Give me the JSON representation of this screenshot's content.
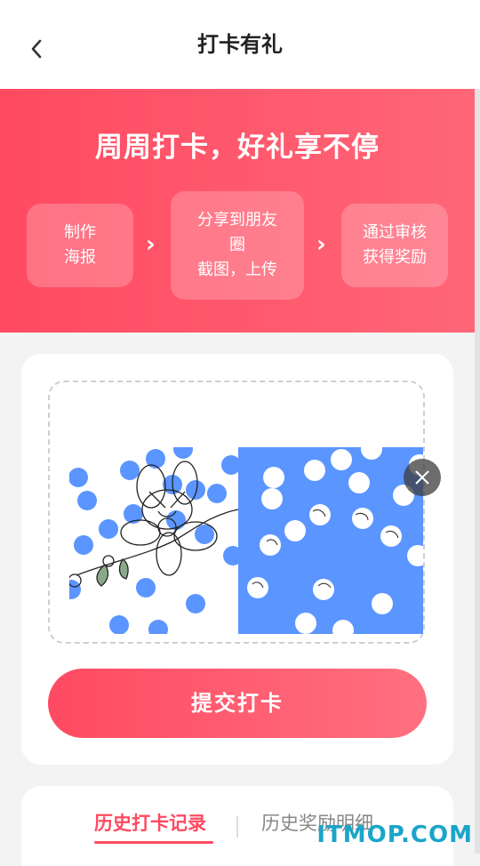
{
  "header": {
    "back_icon": "chevron-left-icon",
    "title": "打卡有礼"
  },
  "banner": {
    "title": "周周打卡，好礼享不停",
    "steps": [
      "制作\n海报",
      "分享到朋友\n圈\n截图，上传",
      "通过审核\n获得奖励"
    ],
    "arrow_icon": "chevron-right-icon"
  },
  "upload": {
    "close_icon": "close-icon"
  },
  "submit_label": "提交打卡",
  "tabs": [
    {
      "label": "历史打卡记录",
      "active": true
    },
    {
      "label": "历史奖励明细",
      "active": false
    }
  ],
  "watermark": "ITMOP.COM",
  "colors": {
    "accent": "#ff4a61",
    "photo_blue": "#5b95ff"
  }
}
